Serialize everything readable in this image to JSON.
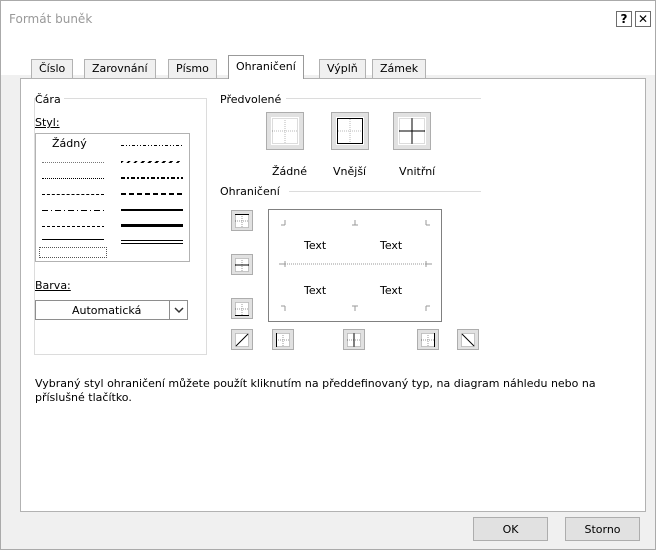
{
  "window": {
    "title": "Formát buněk",
    "help_glyph": "?",
    "close_glyph": "✕"
  },
  "tabs": [
    {
      "label": "Číslo",
      "active": false
    },
    {
      "label": "Zarovnání",
      "active": false
    },
    {
      "label": "Písmo",
      "active": false
    },
    {
      "label": "Ohraničení",
      "active": true
    },
    {
      "label": "Výplň",
      "active": false
    },
    {
      "label": "Zámek",
      "active": false
    }
  ],
  "line_group": {
    "title": "Čára",
    "style_label": "Styl:",
    "none_style_label": "Žádný",
    "color_label": "Barva:",
    "color_value": "Automatická"
  },
  "presets_group": {
    "title": "Předvolené",
    "buttons": [
      {
        "label": "Žádné",
        "icon": "preset-none-icon"
      },
      {
        "label": "Vnější",
        "icon": "preset-outline-icon"
      },
      {
        "label": "Vnitřní",
        "icon": "preset-inside-icon"
      }
    ]
  },
  "border_group": {
    "title": "Ohraničení",
    "preview_texts": [
      "Text",
      "Text",
      "Text",
      "Text"
    ]
  },
  "description": "Vybraný styl ohraničení můžete použít kliknutím na předdefinovaný typ, na diagram náhledu nebo na příslušné tlačítko.",
  "footer": {
    "ok_label": "OK",
    "cancel_label": "Storno"
  },
  "colors": {
    "dialog_bg": "#f0f0f0",
    "button_bg": "#e1e1e1",
    "title_text": "#999999"
  }
}
